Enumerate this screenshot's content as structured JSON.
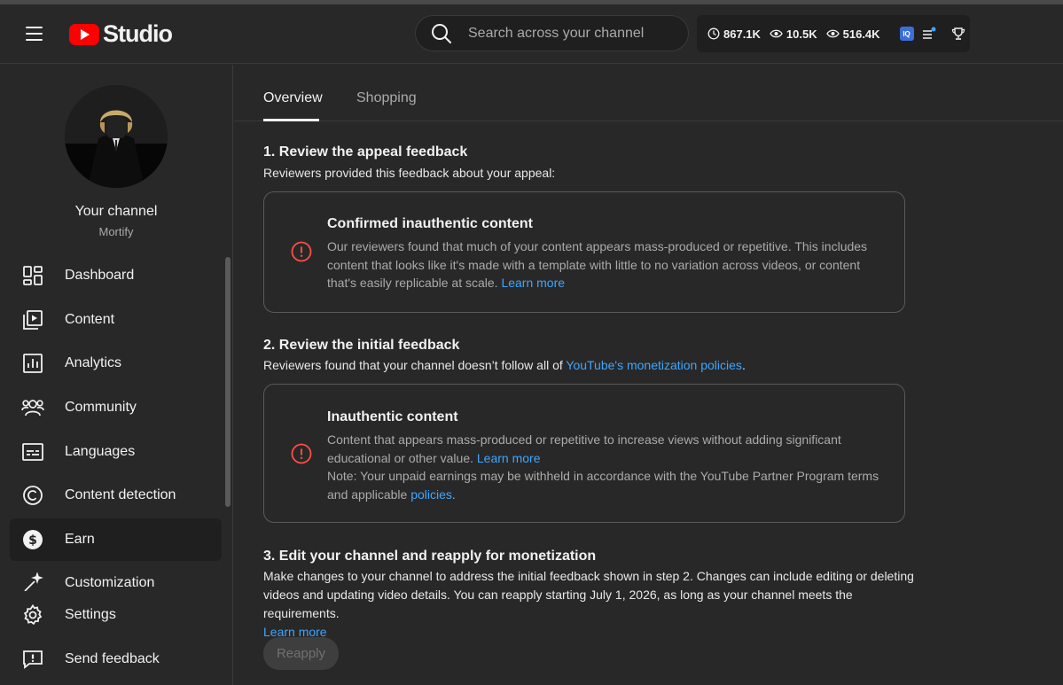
{
  "header": {
    "app_name": "Studio",
    "search_placeholder": "Search across your channel",
    "stats": [
      "867.1K",
      "10.5K",
      "516.4K"
    ],
    "badge": "IQ"
  },
  "sidebar": {
    "channel_title": "Your channel",
    "channel_handle": "Mortify",
    "items": [
      {
        "label": "Dashboard",
        "icon": "dashboard-icon"
      },
      {
        "label": "Content",
        "icon": "content-icon"
      },
      {
        "label": "Analytics",
        "icon": "analytics-icon"
      },
      {
        "label": "Community",
        "icon": "community-icon"
      },
      {
        "label": "Languages",
        "icon": "languages-icon"
      },
      {
        "label": "Content detection",
        "icon": "copyright-icon"
      },
      {
        "label": "Earn",
        "icon": "dollar-icon",
        "active": true
      },
      {
        "label": "Customization",
        "icon": "magic-wand-icon"
      }
    ],
    "bottom_items": [
      {
        "label": "Settings",
        "icon": "gear-icon"
      },
      {
        "label": "Send feedback",
        "icon": "feedback-icon"
      }
    ]
  },
  "tabs": [
    "Overview",
    "Shopping"
  ],
  "sections": {
    "s1": {
      "title": "1. Review the appeal feedback",
      "intro": "Reviewers provided this feedback about your appeal:",
      "card_title": "Confirmed inauthentic content",
      "card_body": "Our reviewers found that much of your content appears mass-produced or repetitive. This includes content that looks like it's made with a template with little to no variation across videos, or content that's easily replicable at scale.",
      "card_link": "Learn more"
    },
    "s2": {
      "title": "2. Review the initial feedback",
      "intro": "Reviewers found that your channel doesn’t follow all of",
      "intro_link": "YouTube's monetization policies",
      "intro_end": ".",
      "card_title": "Inauthentic content",
      "card_body": "Content that appears mass-produced or repetitive to increase views without adding significant educational or other value.",
      "card_link": "Learn more",
      "note": "Note: Your unpaid earnings may be withheld in accordance with the YouTube Partner Program terms and applicable",
      "note_link": "policies",
      "note_end": "."
    },
    "s3": {
      "title": "3. Edit your channel and reapply for monetization",
      "body": "Make changes to your channel to address the initial feedback shown in step 2. Changes can include editing or deleting videos and updating video details. You can reapply starting July 1, 2026, as long as your channel meets the requirements.",
      "link": "Learn more",
      "button": "Reapply"
    }
  },
  "colors": {
    "background": "#282828",
    "link": "#3ea6ff",
    "error": "#ff4e45",
    "brand_red": "#ff0000"
  }
}
